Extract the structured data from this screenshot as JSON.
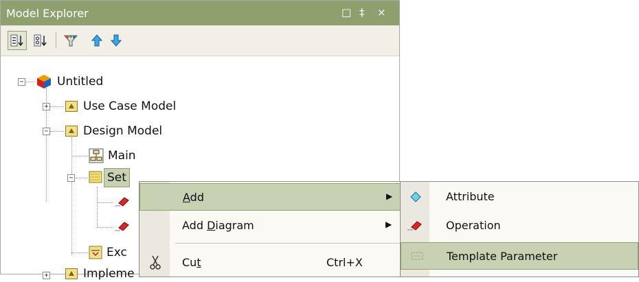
{
  "panel": {
    "title": "Model Explorer",
    "controls": [
      "□",
      "‡",
      "×"
    ]
  },
  "toolbar": {
    "sort_order": "sort-by-order",
    "sort_alpha": "sort-by-name",
    "filter": "filter",
    "move_up": "move-up",
    "move_down": "move-down"
  },
  "tree": {
    "root": "Untitled",
    "use_case_model": "Use Case Model",
    "design_model": "Design Model",
    "main": "Main",
    "set": "Set",
    "exc": "Exc",
    "impl": "Impleme"
  },
  "context_menu": {
    "add": {
      "pre": "",
      "key": "A",
      "post": "dd"
    },
    "add_diagram": {
      "pre": "Add ",
      "key": "D",
      "post": "iagram"
    },
    "cut": {
      "pre": "Cu",
      "key": "t",
      "post": "",
      "shortcut": "Ctrl+X"
    }
  },
  "submenu": {
    "attribute": "Attribute",
    "operation": "Operation",
    "template_parameter": "Template Parameter"
  },
  "colors": {
    "titlebar": "#8ea06e",
    "highlight": "#c8d1b2",
    "highlight_border": "#8ea06e",
    "menu_bg": "#faf9f5",
    "gutter": "#ebe9df"
  }
}
